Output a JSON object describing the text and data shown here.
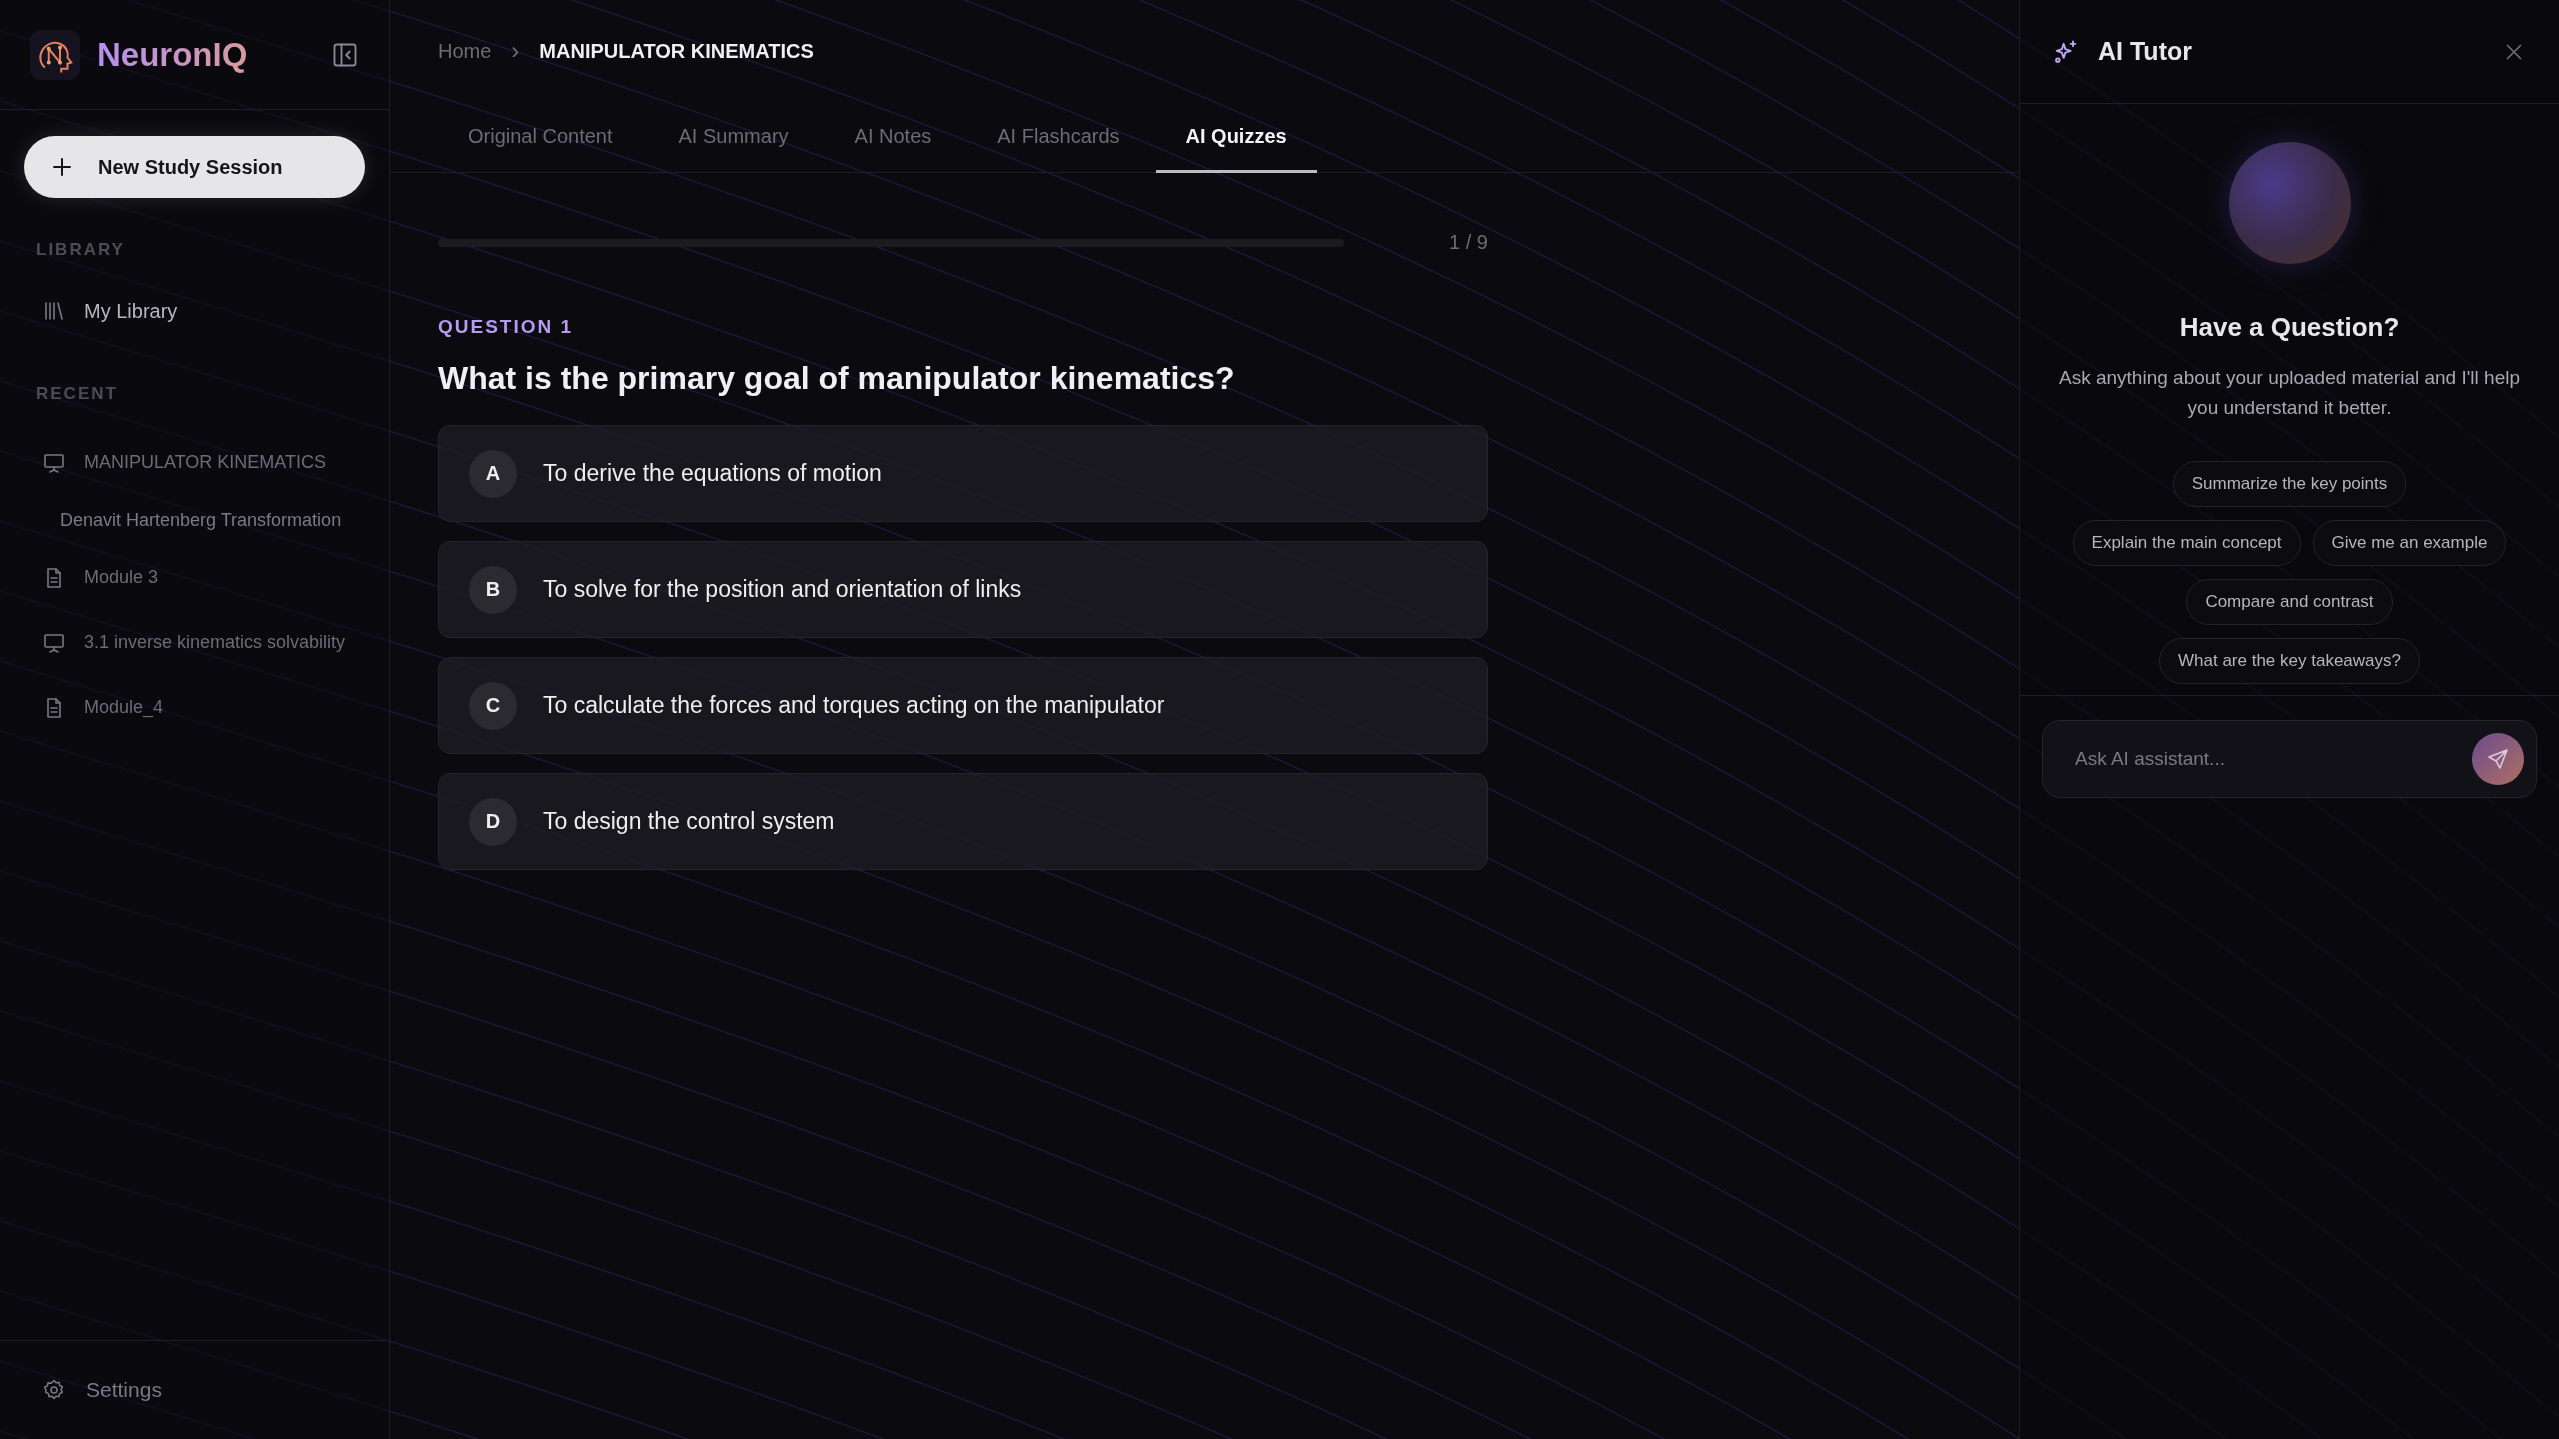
{
  "sidebar": {
    "brand": "NeuronIQ",
    "new_button": "New Study Session",
    "library_heading": "LIBRARY",
    "library_items": [
      {
        "label": "My Library",
        "kind": "library"
      }
    ],
    "recent_heading": "RECENT",
    "recent_items": [
      {
        "label": "MANIPULATOR KINEMATICS",
        "kind": "slides",
        "children": [
          {
            "label": "Denavit Hartenberg Transformation"
          }
        ]
      },
      {
        "label": "Module 3",
        "kind": "document"
      },
      {
        "label": "3.1 inverse kinematics solvability",
        "kind": "slides"
      },
      {
        "label": "Module_4",
        "kind": "document"
      }
    ],
    "settings": "Settings"
  },
  "breadcrumb": {
    "items": [
      "Home",
      "MANIPULATOR KINEMATICS"
    ],
    "separator": "›"
  },
  "tabs": [
    {
      "label": "Original Content",
      "selected": false
    },
    {
      "label": "AI Summary",
      "selected": false
    },
    {
      "label": "AI Notes",
      "selected": false
    },
    {
      "label": "AI Flashcards",
      "selected": false
    },
    {
      "label": "AI Quizzes",
      "selected": true
    }
  ],
  "quiz": {
    "progress": {
      "reading": "1 / 9"
    },
    "question_label": "QUESTION 1",
    "question": "What is the primary goal of manipulator kinematics?",
    "options": [
      {
        "letter": "A",
        "text": "To derive the equations of motion",
        "selected": false
      },
      {
        "letter": "B",
        "text": "To solve for the position and orientation of links",
        "selected": false
      },
      {
        "letter": "C",
        "text": "To calculate the forces and torques acting on the manipulator",
        "selected": false
      },
      {
        "letter": "D",
        "text": "To design the control system",
        "selected": false
      }
    ]
  },
  "tutor": {
    "title": "AI Tutor",
    "heading": "Have a Question?",
    "description": "Ask anything about your uploaded material and I'll help you understand it better.",
    "suggestions": [
      [
        "Summarize the key points"
      ],
      [
        "Explain the main concept",
        "Give me an example"
      ],
      [
        "Compare and contrast"
      ],
      [
        "What are the key takeaways?"
      ]
    ],
    "input": {
      "placeholder": "Ask AI assistant..."
    }
  }
}
